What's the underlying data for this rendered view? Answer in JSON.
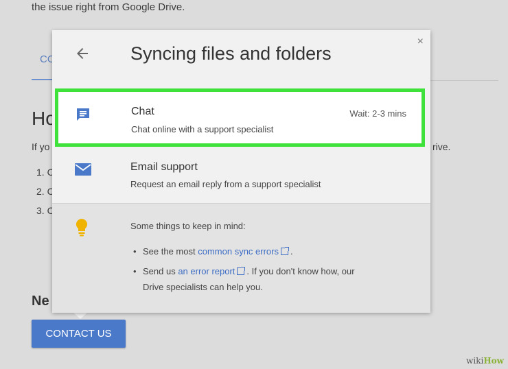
{
  "background": {
    "intro_text": "the issue right from Google Drive.",
    "tab_fragment": "CO",
    "heading_fragment": "Ho",
    "paragraph_fragment": "If yo",
    "paragraph_tail": "rive.",
    "list_items": [
      "1. C",
      "2. C",
      "3. C"
    ],
    "section_heading_fragment": "Ne",
    "contact_button_label": "CONTACT US",
    "watermark_prefix": "wiki",
    "watermark_suffix": "How"
  },
  "dialog": {
    "title": "Syncing files and folders",
    "close_label": "×",
    "options": {
      "chat": {
        "title": "Chat",
        "description": "Chat online with a support specialist",
        "wait": "Wait: 2-3 mins"
      },
      "email": {
        "title": "Email support",
        "description": "Request an email reply from a support specialist"
      }
    },
    "tips": {
      "heading": "Some things to keep in mind:",
      "tip1": {
        "prefix": "See the most",
        "link": "common sync errors",
        "suffix": "."
      },
      "tip2": {
        "prefix": "Send us",
        "link": "an error report",
        "suffix": ". If you don't know how, our",
        "line2": "Drive specialists can help you."
      }
    }
  },
  "colors": {
    "accent_blue": "#4a79c9",
    "highlight_green": "#3fe23a",
    "bulb_yellow": "#f0b400"
  }
}
